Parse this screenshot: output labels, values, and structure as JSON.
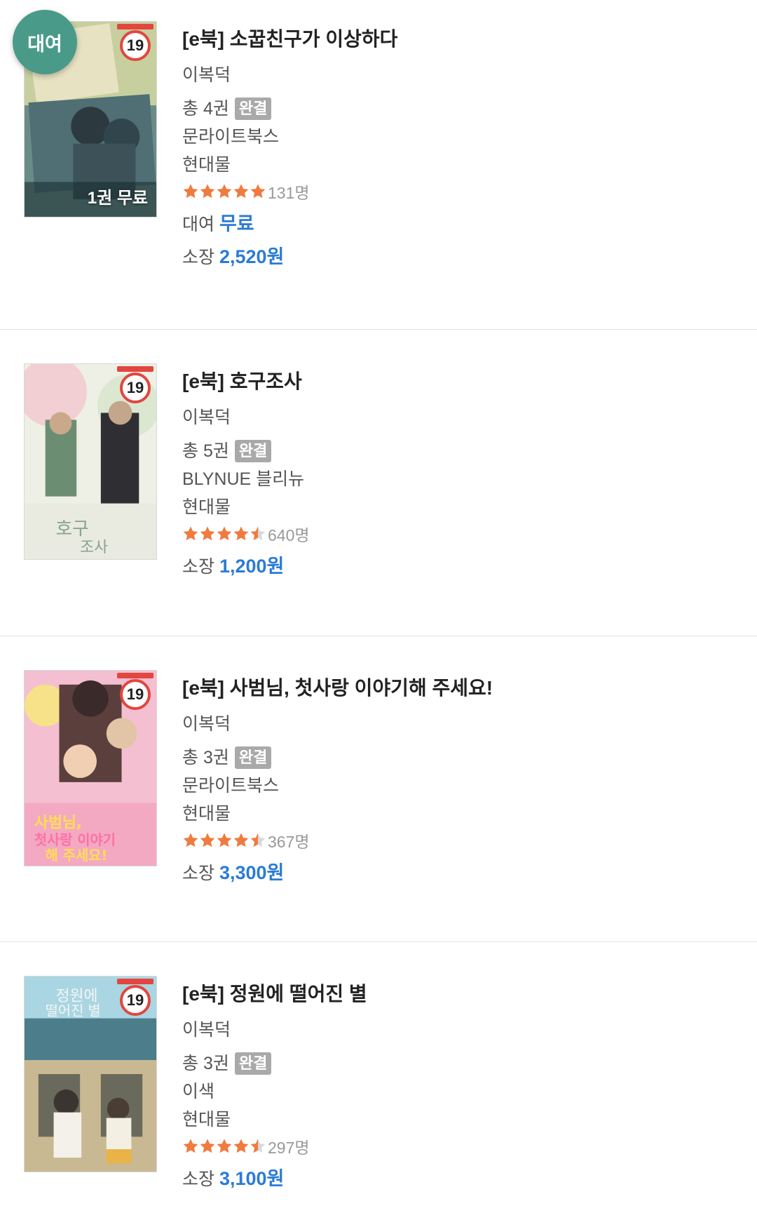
{
  "colors": {
    "price": "#2b7bd6",
    "star": "#f07b3f",
    "rent_badge": "#4a9a8a",
    "done_badge": "#a9a9a9",
    "age_ring": "#e2463f"
  },
  "items": [
    {
      "rent_badge": "대여",
      "age": "19",
      "cover_overlay": "1권 무료",
      "title": "[e북] 소꿉친구가 이상하다",
      "author": "이복덕",
      "volumes": "총 4권",
      "status": "완결",
      "publisher": "문라이트북스",
      "genre": "현대물",
      "rating_stars": 5,
      "rating_count": "131명",
      "rent_label": "대여",
      "rent_price": "무료",
      "own_label": "소장",
      "own_price": "2,520원",
      "cover_colors": [
        "#5b7a74",
        "#a7b9a6",
        "#3e5a66"
      ]
    },
    {
      "age": "19",
      "title": "[e북] 호구조사",
      "author": "이복덕",
      "volumes": "총 5권",
      "status": "완결",
      "publisher": "BLYNUE 블리뉴",
      "genre": "현대물",
      "rating_stars": 4.5,
      "rating_count": "640명",
      "own_label": "소장",
      "own_price": "1,200원",
      "cover_colors": [
        "#dfe7dc",
        "#f2d8d8",
        "#7c9a86"
      ]
    },
    {
      "age": "19",
      "title": "[e북] 사범님, 첫사랑 이야기해 주세요!",
      "author": "이복덕",
      "volumes": "총 3권",
      "status": "완결",
      "publisher": "문라이트북스",
      "genre": "현대물",
      "rating_stars": 4.5,
      "rating_count": "367명",
      "own_label": "소장",
      "own_price": "3,300원",
      "cover_colors": [
        "#f0b6c8",
        "#f7d87a",
        "#8a5a54"
      ]
    },
    {
      "age": "19",
      "title": "[e북] 정원에 떨어진 별",
      "author": "이복덕",
      "volumes": "총 3권",
      "status": "완결",
      "publisher": "이색",
      "genre": "현대물",
      "rating_stars": 4.5,
      "rating_count": "297명",
      "own_label": "소장",
      "own_price": "3,100원",
      "cover_colors": [
        "#9fd0dc",
        "#d9c9a6",
        "#5a7a5a"
      ]
    }
  ]
}
